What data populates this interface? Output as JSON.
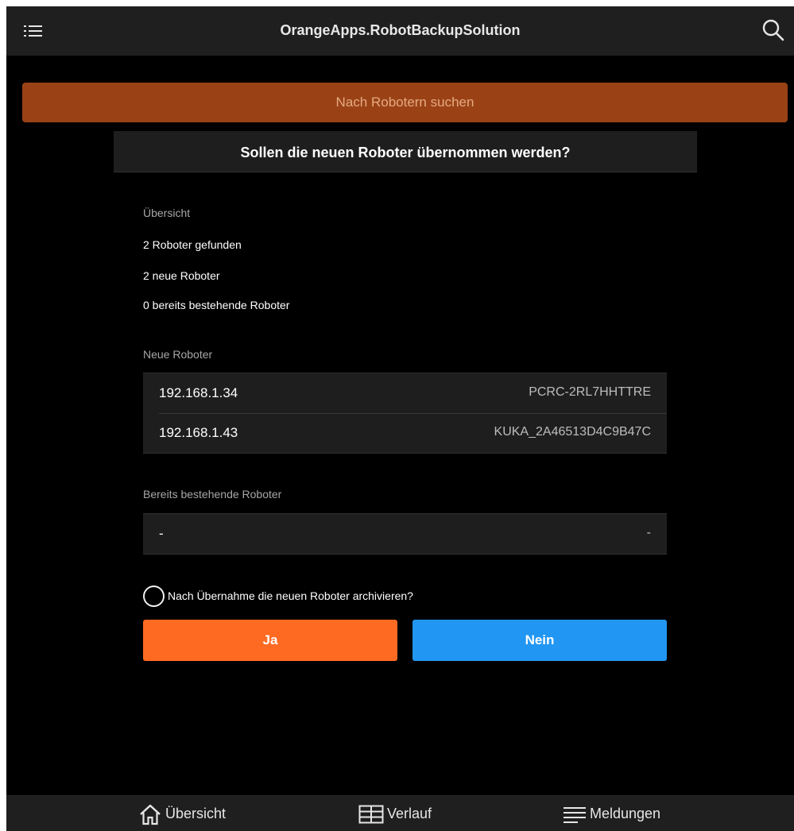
{
  "header": {
    "title": "OrangeApps.RobotBackupSolution",
    "menu_icon": "list-menu-icon",
    "search_icon": "search-icon"
  },
  "search_button": {
    "label": "Nach Robotern suchen"
  },
  "dialog": {
    "title": "Sollen die neuen Roboter übernommen werden?",
    "overview": {
      "heading": "Übersicht",
      "found": "2 Roboter gefunden",
      "new": "2 neue Roboter",
      "existing": "0 bereits bestehende Roboter"
    },
    "new_robots": {
      "heading": "Neue Roboter",
      "rows": [
        {
          "ip": "192.168.1.34",
          "name": "PCRC-2RL7HHTTRE"
        },
        {
          "ip": "192.168.1.43",
          "name": "KUKA_2A46513D4C9B47C"
        }
      ]
    },
    "existing_robots": {
      "heading": "Bereits bestehende Roboter",
      "rows": [
        {
          "ip": "-",
          "name": "-"
        }
      ]
    },
    "archive_checkbox": {
      "label": "Nach Übernahme die neuen Roboter archivieren?",
      "checked": false
    },
    "yes_label": "Ja",
    "no_label": "Nein"
  },
  "bottom_nav": {
    "overview": "Übersicht",
    "history": "Verlauf",
    "messages": "Meldungen"
  },
  "colors": {
    "search_button_bg": "#9a4216",
    "yes_button": "#ff6a22",
    "no_button": "#2196f3",
    "bar_bg": "#1f1f1f"
  }
}
